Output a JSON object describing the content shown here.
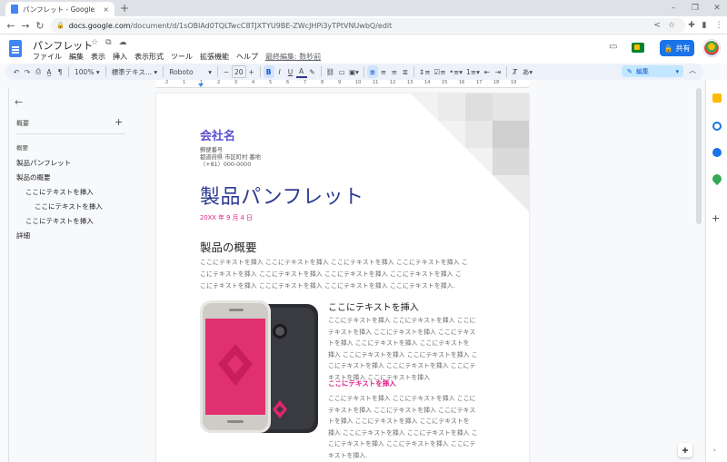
{
  "browser": {
    "tab_title": "パンフレット - Google ドキュメント",
    "tab_close": "×",
    "new_tab": "+",
    "url_host": "docs.google.com",
    "url_path": "/document/d/1sOBlAd0TQLTwcC8TJXTYU9BE-ZWcJHPi3yTPtVNUwbQ/edit"
  },
  "docs": {
    "title": "パンフレット",
    "menu": [
      "ファイル",
      "編集",
      "表示",
      "挿入",
      "表示形式",
      "ツール",
      "拡張機能",
      "ヘルプ"
    ],
    "last_edit": "最終編集: 数秒前",
    "share_label": "共有"
  },
  "toolbar": {
    "zoom": "100%",
    "style": "標準テキス...",
    "font": "Roboto",
    "font_size": "20",
    "mode": "編集"
  },
  "ruler_numbers": [
    "2",
    "1",
    "1",
    "2",
    "3",
    "4",
    "5",
    "6",
    "7",
    "8",
    "9",
    "10",
    "11",
    "12",
    "13",
    "14",
    "15",
    "16",
    "17",
    "18",
    "19"
  ],
  "outline": {
    "heading": "概要",
    "add": "+",
    "subheading": "概要",
    "items": [
      {
        "label": "製品パンフレット",
        "level": 0
      },
      {
        "label": "製品の概要",
        "level": 0
      },
      {
        "label": "ここにテキストを挿入",
        "level": 1
      },
      {
        "label": "ここにテキストを挿入",
        "level": 2
      },
      {
        "label": "ここにテキストを挿入",
        "level": 1
      },
      {
        "label": "詳細",
        "level": 0
      }
    ]
  },
  "document": {
    "company": "会社名",
    "address_lines": [
      "郵便番号",
      "都道府県 市区町村 番地",
      "（+81）000-0000"
    ],
    "main_title": "製品パンフレット",
    "date": "20XX 年 9 月 4 日",
    "overview_heading": "製品の概要",
    "overview_lines": [
      "ここにテキストを挿入 ここにテキストを挿入 ここにテキストを挿入 ここにテキストを挿入 こ",
      "こにテキストを挿入 ここにテキストを挿入 ここにテキストを挿入 ここにテキストを挿入 こ",
      "こにテキストを挿入 ここにテキストを挿入 ここにテキストを挿入 ここにテキストを挿入."
    ],
    "side_heading": "ここにテキストを挿入",
    "side_lines_1": [
      "ここにテキストを挿入 ここにテキストを挿入 ここに",
      "テキストを挿入 ここにテキストを挿入 ここにテキス",
      "トを挿入 ここにテキストを挿入 ここにテキストを",
      "挿入 ここにテキストを挿入 ここにテキストを挿入 こ",
      "こにテキストを挿入 ここにテキストを挿入 ここにテ",
      "キストを挿入 ここにテキストを挿入"
    ],
    "pink_heading": "ここにテキストを挿入",
    "side_lines_2": [
      "ここにテキストを挿入 ここにテキストを挿入 ここに",
      "テキストを挿入 ここにテキストを挿入 ここにテキス",
      "トを挿入 ここにテキストを挿入 ここにテキストを",
      "挿入 ここにテキストを挿入 ここにテキストを挿入 こ",
      "こにテキストを挿入 ここにテキストを挿入 ここにテ",
      "キストを挿入."
    ]
  },
  "colors": {
    "accent_blue": "#1a73e8",
    "company_purple": "#5b4fcf",
    "title_navy": "#2b3a8f",
    "pink": "#e0218a"
  }
}
